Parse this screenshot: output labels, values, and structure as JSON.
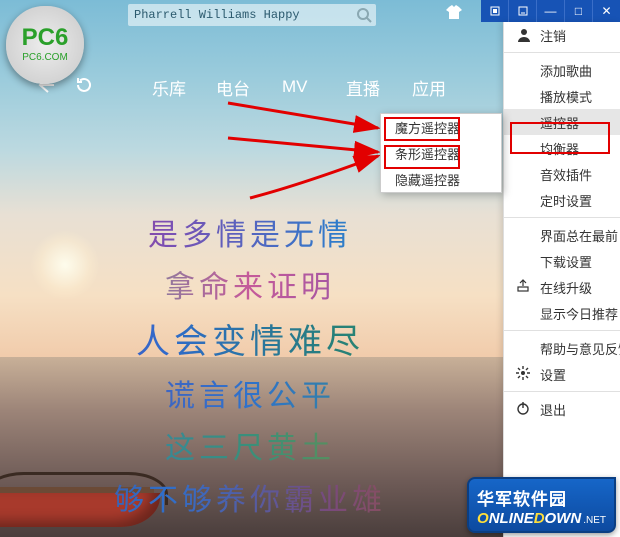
{
  "search": {
    "value": "Pharrell Williams Happy"
  },
  "nav": [
    "乐库",
    "电台",
    "MV",
    "直播",
    "应用"
  ],
  "menu": [
    "注销",
    "添加歌曲",
    "播放模式",
    "遥控器",
    "均衡器",
    "音效插件",
    "定时设置",
    "界面总在最前",
    "下载设置",
    "在线升级",
    "显示今日推荐",
    "帮助与意见反馈",
    "设置",
    "退出"
  ],
  "submenu": [
    "魔方遥控器",
    "条形遥控器",
    "隐藏遥控器"
  ],
  "lyrics": [
    "是多情是无情",
    "拿命来证明",
    "人会变情难尽",
    "谎言很公平",
    "这三尺黄土",
    "够不够养你霸业雄"
  ],
  "watermark": {
    "cn": "华军软件园",
    "net": ".NET"
  },
  "pc6": {
    "title": "PC6",
    "sub": "PC6.COM"
  }
}
